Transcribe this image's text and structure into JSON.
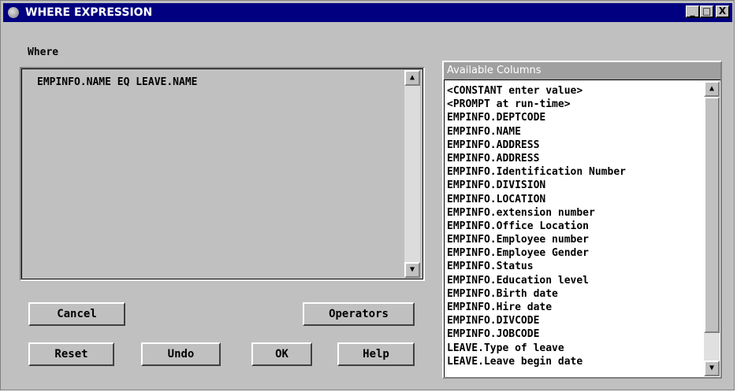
{
  "window": {
    "title": "WHERE EXPRESSION",
    "controls": [
      "_",
      "□",
      "X"
    ]
  },
  "where": {
    "label": "Where",
    "expression": "EMPINFO.NAME EQ LEAVE.NAME"
  },
  "buttons": {
    "cancel": "Cancel",
    "operators": "Operators",
    "reset": "Reset",
    "undo": "Undo",
    "ok": "OK",
    "help": "Help"
  },
  "available_columns": {
    "header": "Available Columns",
    "items": [
      "<CONSTANT enter value>",
      "<PROMPT at run-time>",
      "EMPINFO.DEPTCODE",
      "EMPINFO.NAME",
      "EMPINFO.ADDRESS",
      "EMPINFO.ADDRESS",
      "EMPINFO.Identification Number",
      "EMPINFO.DIVISION",
      "EMPINFO.LOCATION",
      "EMPINFO.extension number",
      "EMPINFO.Office Location",
      "EMPINFO.Employee number",
      "EMPINFO.Employee Gender",
      "EMPINFO.Status",
      "EMPINFO.Education level",
      "EMPINFO.Birth date",
      "EMPINFO.Hire date",
      "EMPINFO.DIVCODE",
      "EMPINFO.JOBCODE",
      "LEAVE.Type of leave",
      "LEAVE.Leave begin date"
    ]
  },
  "icons": {
    "app": "sas-globe-icon",
    "minimize": "minimize-icon",
    "maximize": "maximize-icon",
    "close": "close-icon",
    "scroll_up": "up-arrow-icon",
    "scroll_down": "down-arrow-icon"
  },
  "colors": {
    "titlebar": "#000080",
    "dialog": "#c0c0c0",
    "list_background": "#ffffff",
    "list_header": "#a0a0a0"
  }
}
